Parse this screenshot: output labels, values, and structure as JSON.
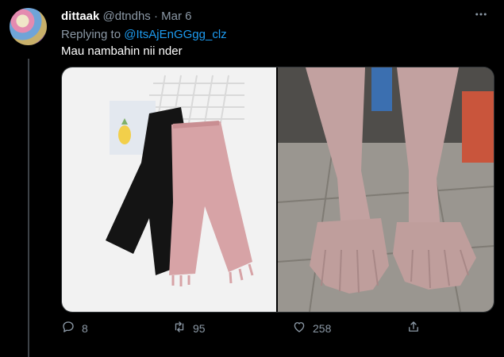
{
  "tweet": {
    "display_name": "dittaak",
    "handle": "@dtndhs",
    "separator": "·",
    "date": "Mar 6",
    "replying_prefix": "Replying to",
    "replying_to": "@ItsAjEnGGgg_clz",
    "text": "Mau nambahin nii nder"
  },
  "actions": {
    "replies": "8",
    "retweets": "95",
    "likes": "258"
  },
  "icons": {
    "more": "more-icon",
    "reply": "reply-icon",
    "retweet": "retweet-icon",
    "like": "heart-icon",
    "share": "share-icon"
  },
  "colors": {
    "background": "#000000",
    "name": "#ffffff",
    "secondary": "#8b98a5",
    "mention": "#1d9bf0",
    "divider": "#2f3336"
  }
}
